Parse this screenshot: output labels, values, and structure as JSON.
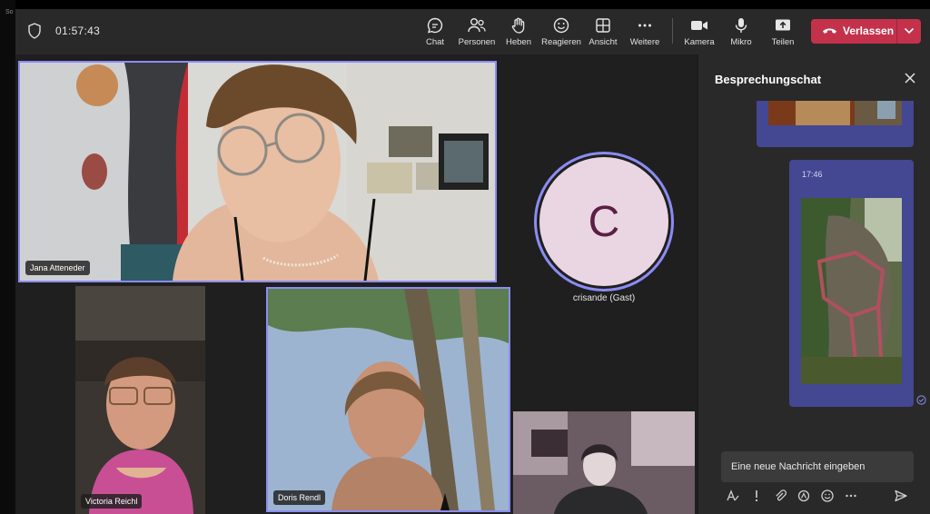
{
  "meeting": {
    "timer": "01:57:43"
  },
  "toolbar": {
    "items": [
      {
        "label": "Chat",
        "icon": "chat-icon"
      },
      {
        "label": "Personen",
        "icon": "people-icon"
      },
      {
        "label": "Heben",
        "icon": "raise-hand-icon"
      },
      {
        "label": "Reagieren",
        "icon": "smiley-icon"
      },
      {
        "label": "Ansicht",
        "icon": "grid-icon"
      },
      {
        "label": "Weitere",
        "icon": "more-icon"
      },
      {
        "label": "Kamera",
        "icon": "camera-icon"
      },
      {
        "label": "Mikro",
        "icon": "mic-icon"
      },
      {
        "label": "Teilen",
        "icon": "share-icon"
      }
    ],
    "leave_label": "Verlassen"
  },
  "participants": [
    {
      "name": "Jana Atteneder",
      "active": true
    },
    {
      "name": "Victoria Reichl",
      "active": false
    },
    {
      "name": "Doris Rendl",
      "active": true
    },
    {
      "name": "",
      "active": false
    }
  ],
  "guest": {
    "initial": "C",
    "name": "crisande (Gast)"
  },
  "chat": {
    "title": "Besprechungschat",
    "messages": [
      {
        "time": ""
      },
      {
        "time": "17:46"
      }
    ],
    "input_placeholder": "Eine neue Nachricht eingeben"
  },
  "colors": {
    "accent": "#8b8cf4",
    "leave": "#c4314b",
    "bubble": "#444791",
    "avatar_bg": "#ead6e3",
    "avatar_text": "#5b1f45"
  }
}
